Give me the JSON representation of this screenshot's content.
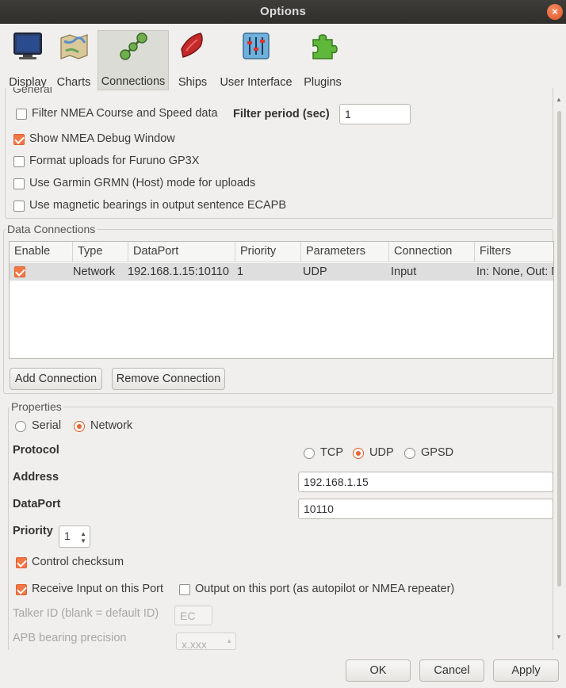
{
  "window": {
    "title": "Options",
    "close_symbol": "×"
  },
  "toolbar": {
    "tabs": [
      {
        "label": "Display",
        "icon": "monitor-icon"
      },
      {
        "label": "Charts",
        "icon": "charts-icon"
      },
      {
        "label": "Connections",
        "icon": "connections-icon",
        "active": true
      },
      {
        "label": "Ships",
        "icon": "ship-icon"
      },
      {
        "label": "User Interface",
        "icon": "sliders-icon"
      },
      {
        "label": "Plugins",
        "icon": "puzzle-icon"
      }
    ]
  },
  "general": {
    "legend": "General",
    "filter_nmea": {
      "label": "Filter NMEA Course and Speed data",
      "checked": false
    },
    "filter_period_label": "Filter period (sec)",
    "filter_period_value": "1",
    "show_debug": {
      "label": "Show NMEA Debug Window",
      "checked": true
    },
    "furuno": {
      "label": "Format uploads for Furuno GP3X",
      "checked": false
    },
    "garmin": {
      "label": "Use Garmin GRMN (Host) mode for uploads",
      "checked": false
    },
    "magnetic": {
      "label": "Use magnetic bearings in output sentence ECAPB",
      "checked": false
    }
  },
  "data_connections": {
    "legend": "Data Connections",
    "columns": [
      "Enable",
      "Type",
      "DataPort",
      "Priority",
      "Parameters",
      "Connection",
      "Filters"
    ],
    "rows": [
      {
        "enabled": true,
        "type": "Network",
        "dataport": "192.168.1.15:10110",
        "priority": "1",
        "parameters": "UDP",
        "connection": "Input",
        "filters": "In: None, Out: N"
      }
    ],
    "add_button": "Add Connection",
    "remove_button": "Remove Connection"
  },
  "properties": {
    "legend": "Properties",
    "serial_label": "Serial",
    "network_label": "Network",
    "selected_type": "Network",
    "protocol_label": "Protocol",
    "protocol_options": [
      "TCP",
      "UDP",
      "GPSD"
    ],
    "protocol_selected": "UDP",
    "address_label": "Address",
    "address_value": "192.168.1.15",
    "dataport_label": "DataPort",
    "dataport_value": "10110",
    "priority_label": "Priority",
    "priority_value": "1",
    "control_checksum": {
      "label": "Control checksum",
      "checked": true
    },
    "receive_input": {
      "label": "Receive Input on this Port",
      "checked": true
    },
    "output_port": {
      "label": "Output on this port (as autopilot or NMEA repeater)",
      "checked": false
    },
    "talker_label": "Talker ID (blank = default ID)",
    "talker_placeholder": "EC",
    "apb_label": "APB bearing precision",
    "apb_value": "x.xxx"
  },
  "buttons": {
    "ok": "OK",
    "cancel": "Cancel",
    "apply": "Apply"
  },
  "colors": {
    "accent": "#e9643a",
    "titlebar": "#3a3935",
    "background": "#f0efed"
  }
}
